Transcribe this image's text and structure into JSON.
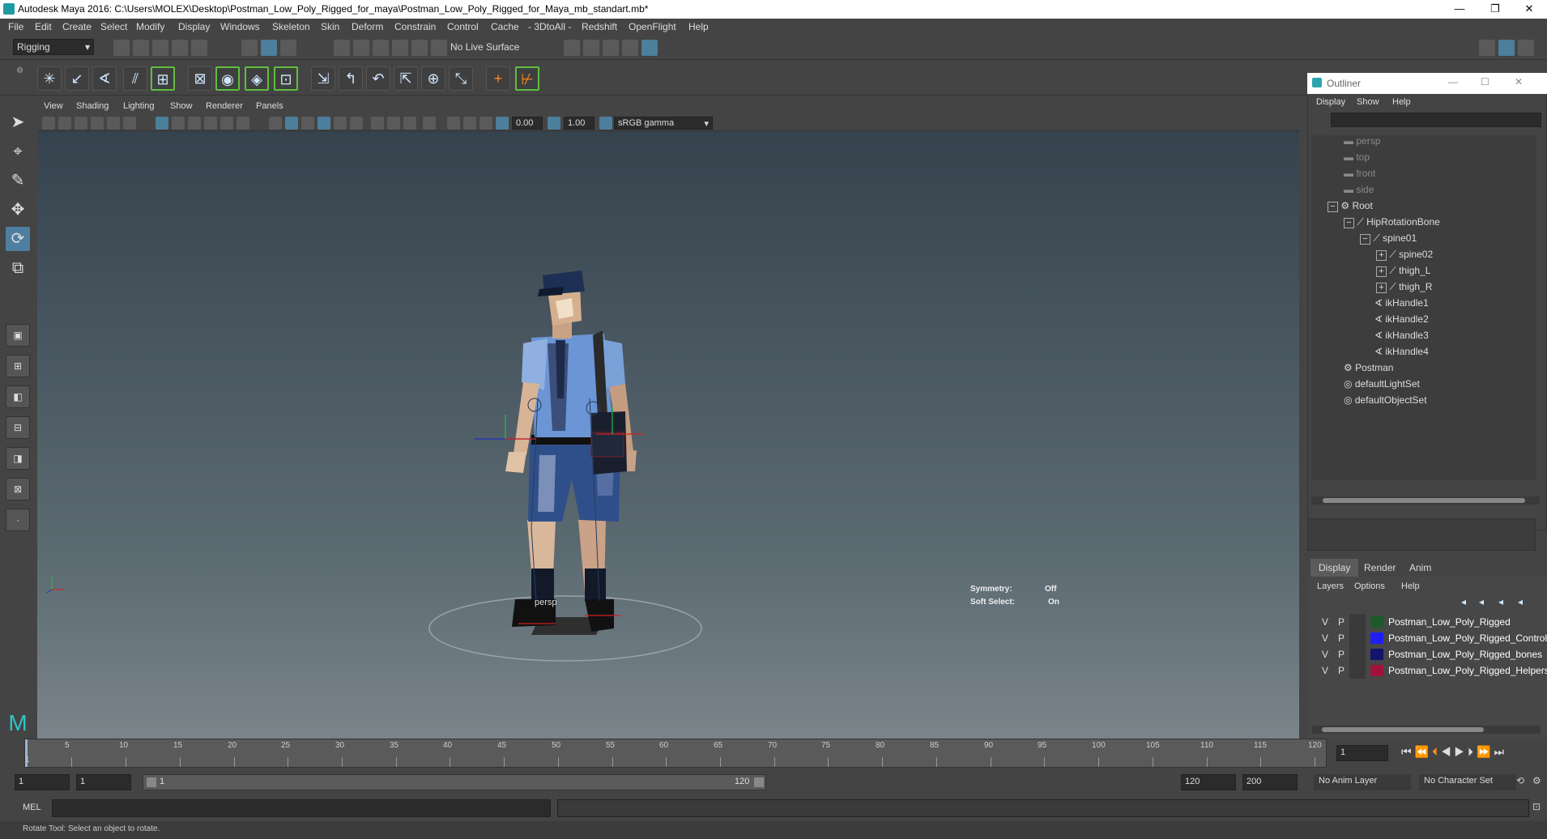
{
  "window": {
    "title": "Autodesk Maya 2016: C:\\Users\\MOLEX\\Desktop\\Postman_Low_Poly_Rigged_for_maya\\Postman_Low_Poly_Rigged_for_Maya_mb_standart.mb*",
    "minimize": "—",
    "maximize": "❐",
    "close": "✕"
  },
  "menubar": [
    "File",
    "Edit",
    "Create",
    "Select",
    "Modify",
    "Display",
    "Windows",
    "Skeleton",
    "Skin",
    "Deform",
    "Constrain",
    "Control",
    "Cache",
    "- 3DtoAll -",
    "Redshift",
    "OpenFlight",
    "Help"
  ],
  "statusline": {
    "mode": "Rigging",
    "live_surface": "No Live Surface"
  },
  "viewport": {
    "menu": [
      "View",
      "Shading",
      "Lighting",
      "Show",
      "Renderer",
      "Panels"
    ],
    "exposure": "0.00",
    "gamma": "1.00",
    "color_space": "sRGB gamma",
    "camera_label": "persp",
    "symmetry_label": "Symmetry:",
    "symmetry_value": "Off",
    "soft_select_label": "Soft Select:",
    "soft_select_value": "On"
  },
  "outliner": {
    "title": "Outliner",
    "menu": [
      "Display",
      "Show",
      "Help"
    ],
    "items": [
      {
        "label": "persp",
        "icon": "camera-icon",
        "dim": true
      },
      {
        "label": "top",
        "icon": "camera-icon",
        "dim": true
      },
      {
        "label": "front",
        "icon": "camera-icon",
        "dim": true
      },
      {
        "label": "side",
        "icon": "camera-icon",
        "dim": true
      },
      {
        "label": "Root",
        "icon": "group-icon",
        "expander": "−"
      },
      {
        "label": "HipRotationBone",
        "icon": "joint-icon",
        "expander": "−"
      },
      {
        "label": "spine01",
        "icon": "joint-icon",
        "expander": "−"
      },
      {
        "label": "spine02",
        "icon": "joint-icon",
        "expander": "+"
      },
      {
        "label": "thigh_L",
        "icon": "joint-icon",
        "expander": "+"
      },
      {
        "label": "thigh_R",
        "icon": "joint-icon",
        "expander": "+"
      },
      {
        "label": "ikHandle1",
        "icon": "ik-handle-icon"
      },
      {
        "label": "ikHandle2",
        "icon": "ik-handle-icon"
      },
      {
        "label": "ikHandle3",
        "icon": "ik-handle-icon"
      },
      {
        "label": "ikHandle4",
        "icon": "ik-handle-icon"
      },
      {
        "label": "Postman",
        "icon": "group-icon"
      },
      {
        "label": "defaultLightSet",
        "icon": "set-icon"
      },
      {
        "label": "defaultObjectSet",
        "icon": "set-icon"
      }
    ]
  },
  "layer_editor": {
    "tabs": [
      "Display",
      "Render",
      "Anim"
    ],
    "menu": [
      "Layers",
      "Options",
      "Help"
    ],
    "visible_flag": "V",
    "playback_flag": "P",
    "layers": [
      {
        "name": "Postman_Low_Poly_Rigged",
        "color": "#1c5a2a"
      },
      {
        "name": "Postman_Low_Poly_Rigged_Controllers",
        "color": "#1f1ff5"
      },
      {
        "name": "Postman_Low_Poly_Rigged_bones",
        "color": "#14146e"
      },
      {
        "name": "Postman_Low_Poly_Rigged_Helpers",
        "color": "#a0143c"
      }
    ]
  },
  "timeline": {
    "ticks": [
      "5",
      "10",
      "15",
      "20",
      "25",
      "30",
      "35",
      "40",
      "45",
      "50",
      "55",
      "60",
      "65",
      "70",
      "75",
      "80",
      "85",
      "90",
      "95",
      "100",
      "105",
      "110",
      "115",
      "120"
    ],
    "first_tick": "1",
    "current_frame": "1"
  },
  "range": {
    "start": "1",
    "playback_start": "1",
    "slider_start": "1",
    "slider_end": "120",
    "playback_end": "120",
    "end": "200",
    "anim_layer": "No Anim Layer",
    "character_set": "No Character Set"
  },
  "command": {
    "lang": "MEL"
  },
  "help_line": "Rotate Tool: Select an object to rotate."
}
